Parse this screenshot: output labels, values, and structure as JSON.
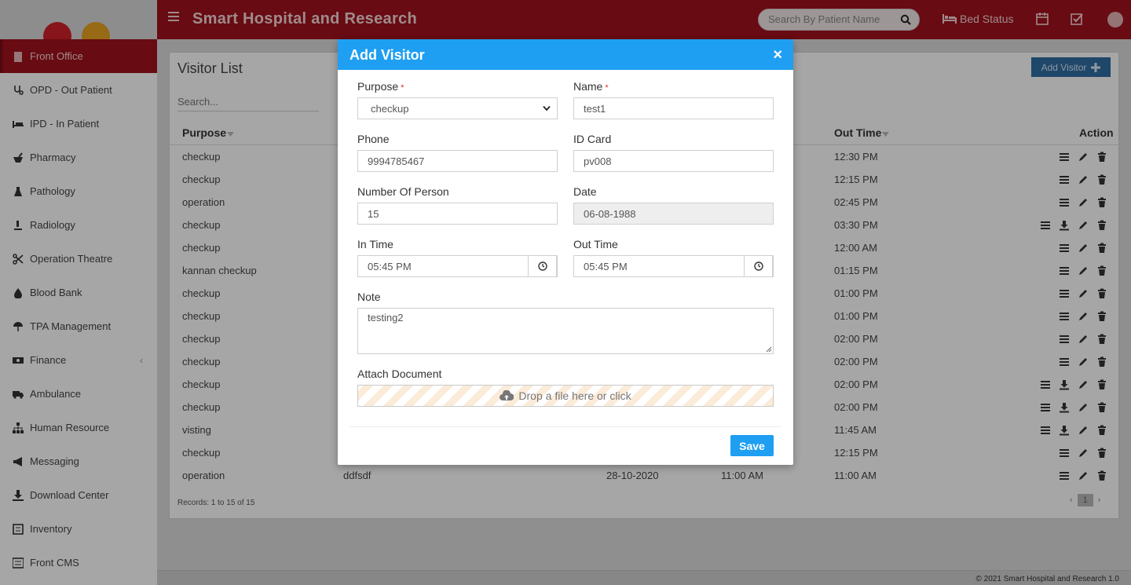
{
  "header": {
    "title": "Smart Hospital and Research",
    "search_placeholder": "Search By Patient Name",
    "bed_status_label": "Bed Status"
  },
  "sidebar": {
    "items": [
      {
        "label": "Front Office",
        "icon": "building-icon",
        "active": true
      },
      {
        "label": "OPD - Out Patient",
        "icon": "stethoscope-icon"
      },
      {
        "label": "IPD - In Patient",
        "icon": "bed-icon"
      },
      {
        "label": "Pharmacy",
        "icon": "mortar-icon"
      },
      {
        "label": "Pathology",
        "icon": "flask-icon"
      },
      {
        "label": "Radiology",
        "icon": "microscope-icon"
      },
      {
        "label": "Operation Theatre",
        "icon": "scissors-icon"
      },
      {
        "label": "Blood Bank",
        "icon": "droplet-icon"
      },
      {
        "label": "TPA Management",
        "icon": "umbrella-icon"
      },
      {
        "label": "Finance",
        "icon": "money-icon",
        "has_arrow": true
      },
      {
        "label": "Ambulance",
        "icon": "ambulance-icon"
      },
      {
        "label": "Human Resource",
        "icon": "sitemap-icon"
      },
      {
        "label": "Messaging",
        "icon": "bullhorn-icon"
      },
      {
        "label": "Download Center",
        "icon": "download-icon"
      },
      {
        "label": "Inventory",
        "icon": "inventory-icon"
      },
      {
        "label": "Front CMS",
        "icon": "cms-icon"
      }
    ]
  },
  "visitor_list": {
    "title": "Visitor List",
    "add_button": "Add Visitor",
    "search_placeholder": "Search...",
    "columns": {
      "purpose": "Purpose",
      "out_time": "Out Time",
      "action": "Action"
    },
    "rows": [
      {
        "purpose": "checkup",
        "out_time": "12:30 PM",
        "icons": 3
      },
      {
        "purpose": "checkup",
        "out_time": "12:15 PM",
        "icons": 3
      },
      {
        "purpose": "operation",
        "out_time": "02:45 PM",
        "icons": 3
      },
      {
        "purpose": "checkup",
        "out_time": "03:30 PM",
        "icons": 4
      },
      {
        "purpose": "checkup",
        "out_time": "12:00 AM",
        "icons": 3
      },
      {
        "purpose": "kannan checkup",
        "out_time": "01:15 PM",
        "icons": 3
      },
      {
        "purpose": "checkup",
        "out_time": "01:00 PM",
        "icons": 3
      },
      {
        "purpose": "checkup",
        "out_time": "01:00 PM",
        "icons": 3
      },
      {
        "purpose": "checkup",
        "out_time": "02:00 PM",
        "icons": 3
      },
      {
        "purpose": "checkup",
        "out_time": "02:00 PM",
        "icons": 3
      },
      {
        "purpose": "checkup",
        "out_time": "02:00 PM",
        "icons": 4
      },
      {
        "purpose": "checkup",
        "out_time": "02:00 PM",
        "icons": 4
      },
      {
        "purpose": "visting",
        "out_time": "11:45 AM",
        "icons": 4
      },
      {
        "purpose": "checkup",
        "out_time": "12:15 PM",
        "icons": 3
      },
      {
        "purpose": "operation",
        "name": "ddfsdf",
        "date": "28-10-2020",
        "in_time": "11:00 AM",
        "out_time": "11:00 AM",
        "icons": 3
      }
    ],
    "records_text": "Records: 1 to 15 of 15",
    "current_page": "1"
  },
  "footer": {
    "text": "© 2021 Smart Hospital and Research 1.0"
  },
  "modal": {
    "title": "Add Visitor",
    "close": "×",
    "purpose_label": "Purpose",
    "purpose_value": "checkup",
    "name_label": "Name",
    "name_value": "test1",
    "phone_label": "Phone",
    "phone_value": "9994785467",
    "idcard_label": "ID Card",
    "idcard_value": "pv008",
    "persons_label": "Number Of Person",
    "persons_value": "15",
    "date_label": "Date",
    "date_value": "06-08-1988",
    "intime_label": "In Time",
    "intime_value": "05:45 PM",
    "outtime_label": "Out Time",
    "outtime_value": "05:45 PM",
    "note_label": "Note",
    "note_value": "testing2",
    "attach_label": "Attach Document",
    "dropzone_text": "Drop a file here or click",
    "save_label": "Save"
  },
  "colors": {
    "header": "#a0121c",
    "modal_header": "#1e9ff2",
    "primary_button": "#1e9ff2"
  }
}
